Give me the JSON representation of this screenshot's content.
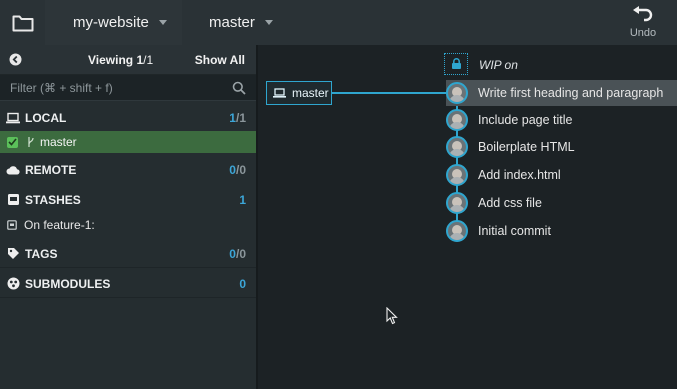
{
  "toolbar": {
    "repo": "my-website",
    "branch": "master",
    "undo_label": "Undo"
  },
  "sidebar": {
    "viewing_label": "Viewing",
    "viewing_current": "1",
    "viewing_total": "/1",
    "show_all": "Show All",
    "filter_placeholder": "Filter (⌘ + shift + f)",
    "sections": {
      "local": {
        "title": "LOCAL",
        "count_a": "1",
        "count_b": "/1"
      },
      "local_branch": "master",
      "remote": {
        "title": "REMOTE",
        "count_a": "0",
        "count_b": "/0"
      },
      "stashes": {
        "title": "STASHES",
        "count_a": "1"
      },
      "stash_item": "On feature-1:",
      "tags": {
        "title": "TAGS",
        "count_a": "0",
        "count_b": "/0"
      },
      "submodules": {
        "title": "SUBMODULES",
        "count_a": "0"
      }
    }
  },
  "graph": {
    "branch_label": "master",
    "wip_label": "WIP on",
    "commits": [
      "Write first heading and paragraph",
      "Include page title",
      "Boilerplate HTML",
      "Add index.html",
      "Add css file",
      "Initial commit"
    ]
  },
  "colors": {
    "accent": "#2fa6cf",
    "selected_branch_bg": "#3c6b3f",
    "count_highlight": "#3ca6d8"
  }
}
